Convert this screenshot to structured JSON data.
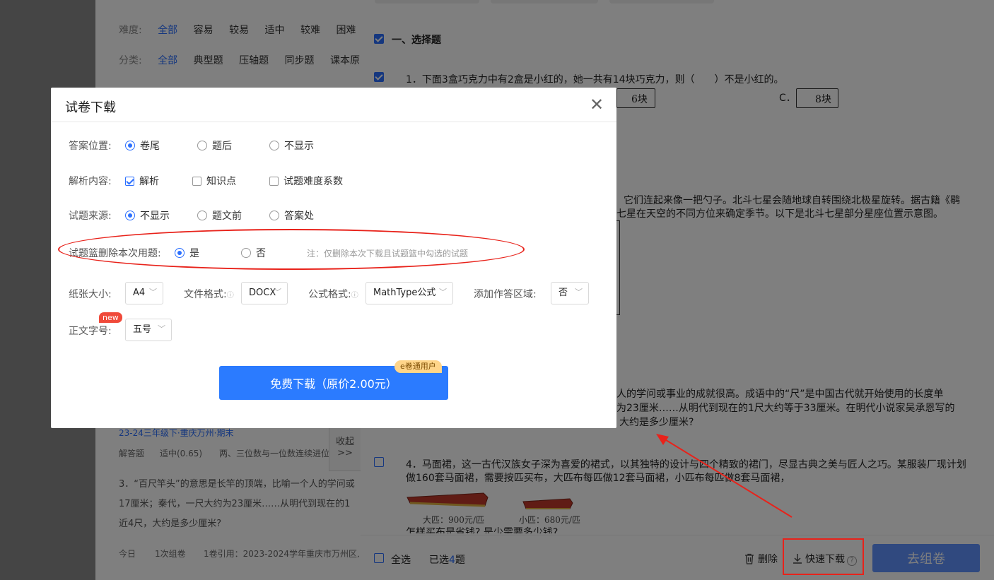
{
  "filters": {
    "difficulty_label": "难度:",
    "difficulty_options": [
      "全部",
      "容易",
      "较易",
      "适中",
      "较难",
      "困难"
    ],
    "category_label": "分类:",
    "category_options": [
      "全部",
      "典型题",
      "压轴题",
      "同步题",
      "课本原"
    ]
  },
  "left_list": {
    "tag": "23-24三年级下·重庆万州·期末",
    "meta": [
      "解答题",
      "适中(0.65)",
      "两、三位数与一位数连续进位"
    ],
    "collapse_label": "收起",
    "collapse_arrow": ">>",
    "question_lines": [
      "3．“百尺竿头”的意思是长竿的顶端，比喻一个人的学问或",
      "17厘米；秦代，一尺大约为23厘米……从明代到现在的1",
      "近4尺，大约是多少厘米?"
    ],
    "footer": [
      "今日",
      "1次组卷",
      "1卷引用：2023-2024学年重庆市万州区人"
    ]
  },
  "right_panel": {
    "section_title": "一、选择题",
    "q1": "1．下面3盒巧克力中有2盒是小红的，她一共有14块巧克力，则（　　）不是小红的。",
    "q1_option_c": "C．",
    "box_b_label": "6块",
    "box_c_label": "8块",
    "q2_lines": [
      "它们连起来像一把勺子。北斗七星会随地球自转围绕北极星旋转。据古籍《鹖",
      "七星在天空的不同方位来确定季节。以下是北斗七星部分星座位置示意图。"
    ],
    "q3_lines": [
      "人的学问或事业的成就很高。成语中的“尺”是中国古代就开始使用的长度单",
      "为23厘米……从明代到现在的1尺大约等于33厘米。在明代小说家吴承恩写的",
      "大约是多少厘米?"
    ],
    "q4_lines": [
      "4．马面裙，这一古代汉族女子深为喜爱的裙式，以其独特的设计与四个精致的裙门，尽显古典之美与匠人之巧。某服装厂现计划",
      "做160套马面裙，需要按匹买布，大匹布每匹做12套马面裙，小匹布每匹做8套马面裙，"
    ],
    "fabric_big": "大匹：900元/匹",
    "fabric_small": "小匹：680元/匹",
    "q4_tail": "怎样买布是省钱? 是少需要多少钱?"
  },
  "bottom_bar": {
    "select_all": "全选",
    "selected_prefix": "已选",
    "selected_count": "4",
    "selected_suffix": "题",
    "delete": "删除",
    "quick_download": "快速下载",
    "build_paper": "去组卷"
  },
  "modal": {
    "title": "试卷下载",
    "answer_position": {
      "label": "答案位置:",
      "options": [
        "卷尾",
        "题后",
        "不显示"
      ],
      "selected": "卷尾"
    },
    "analysis_content": {
      "label": "解析内容:",
      "options": [
        "解析",
        "知识点",
        "试题难度系数"
      ],
      "checked": [
        "解析"
      ]
    },
    "question_source": {
      "label": "试题来源:",
      "options": [
        "不显示",
        "题文前",
        "答案处"
      ],
      "selected": "不显示"
    },
    "delete_used": {
      "label": "试题篮删除本次用题:",
      "options": [
        "是",
        "否"
      ],
      "selected": "是",
      "note": "注：仅删除本次下载且试题篮中勾选的试题"
    },
    "paper_size": {
      "label": "纸张大小:",
      "value": "A4"
    },
    "file_format": {
      "label": "文件格式:",
      "value": "DOCX"
    },
    "formula_format": {
      "label": "公式格式:",
      "value": "MathType公式"
    },
    "answer_area": {
      "label": "添加作答区域:",
      "value": "否"
    },
    "font_size": {
      "label": "正文字号:",
      "value": "五号",
      "badge": "new"
    },
    "download_button": "免费下载（原价2.00元）",
    "user_badge": "e卷通用户"
  },
  "colors": {
    "accent": "#2b6fff",
    "annotation_red": "#e8221a",
    "badge_gold": "#ffd58a"
  }
}
